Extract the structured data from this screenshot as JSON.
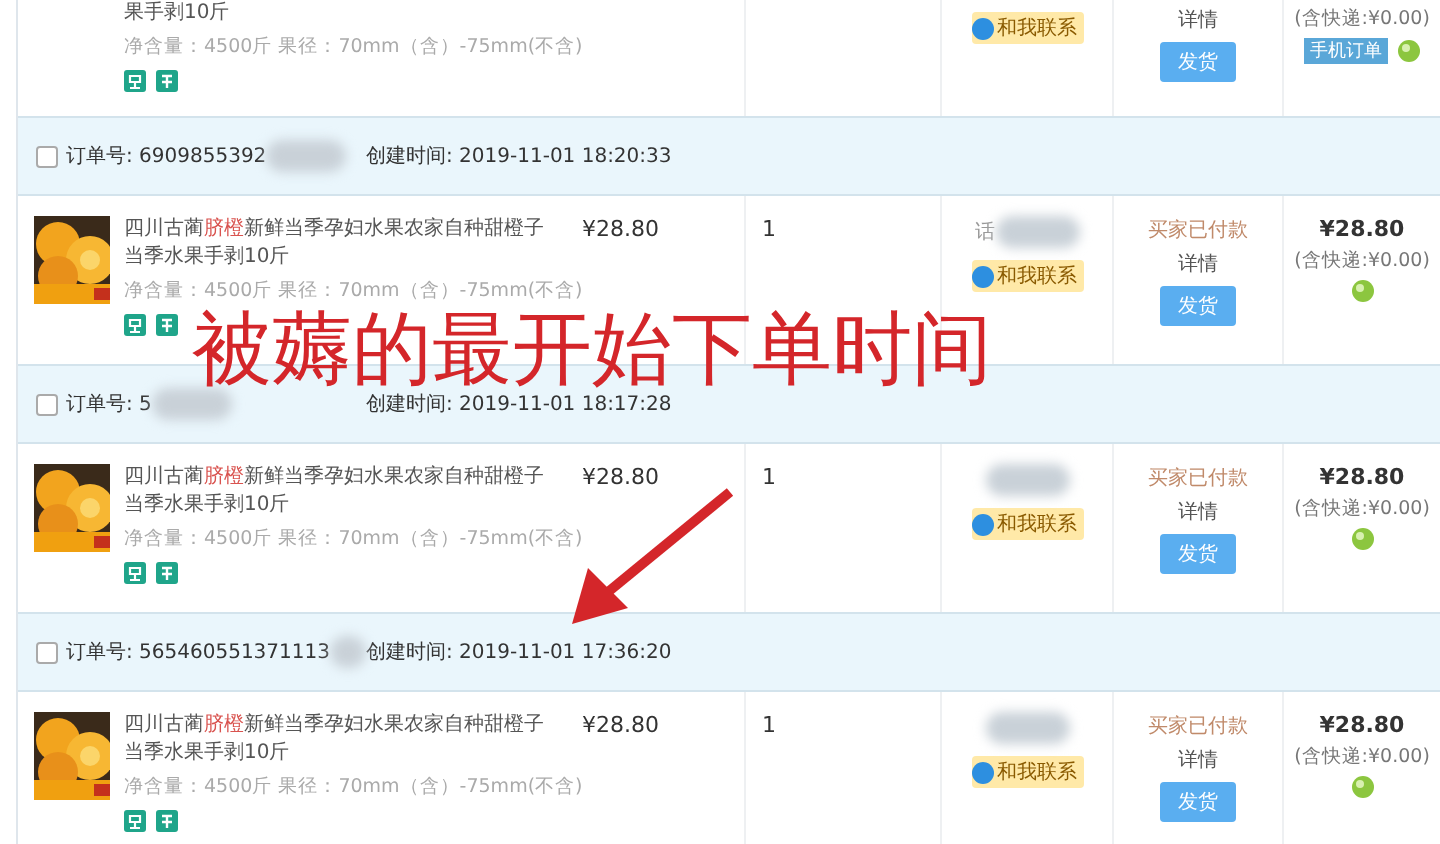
{
  "orders": [
    {
      "product": {
        "title_parts": [
          {
            "text": "果手剥10斤",
            "highlighted": false
          }
        ],
        "spec": "净含量：4500斤  果径：70mm（含）-75mm(不含)"
      },
      "buyer": {
        "contact": "和我联系"
      },
      "status": {
        "details": "详情",
        "button": "发货"
      },
      "total": {
        "shipping": "(含快递:¥0.00)",
        "mobile_tag": "手机订单"
      }
    },
    {
      "header": {
        "order_no": "订单号: 6909855392",
        "redacted": true,
        "created": "创建时间: 2019-11-01 18:20:33",
        "checked": false
      },
      "product": {
        "title_parts": [
          {
            "text": "四川古蔺",
            "highlighted": false
          },
          {
            "text": "脐橙",
            "highlighted": true
          },
          {
            "text": "新鲜当季孕妇水果农家自种甜橙子当季水果手剥10斤",
            "highlighted": false
          }
        ],
        "spec": "净含量：4500斤  果径：70mm（含）-75mm(不含)"
      },
      "price": "¥28.80",
      "quantity": "1",
      "buyer": {
        "name": "话",
        "redacted": true,
        "contact": "和我联系"
      },
      "status": {
        "state": "买家已付款",
        "details": "详情",
        "button": "发货"
      },
      "total": {
        "amount": "¥28.80",
        "shipping": "(含快递:¥0.00)"
      }
    },
    {
      "header": {
        "order_no": "订单号: 5",
        "redacted": true,
        "created": "创建时间: 2019-11-01 18:17:28",
        "checked": false
      },
      "product": {
        "title_parts": [
          {
            "text": "四川古蔺",
            "highlighted": false
          },
          {
            "text": "脐橙",
            "highlighted": true
          },
          {
            "text": "新鲜当季孕妇水果农家自种甜橙子当季水果手剥10斤",
            "highlighted": false
          }
        ],
        "spec": "净含量：4500斤  果径：70mm（含）-75mm(不含)"
      },
      "price": "¥28.80",
      "quantity": "1",
      "buyer": {
        "redacted": true,
        "contact": "和我联系"
      },
      "status": {
        "state": "买家已付款",
        "details": "详情",
        "button": "发货"
      },
      "total": {
        "amount": "¥28.80",
        "shipping": "(含快递:¥0.00)"
      }
    },
    {
      "header": {
        "order_no": "订单号: 565460551371113",
        "redacted": true,
        "created": "创建时间: 2019-11-01 17:36:20",
        "checked": false
      },
      "product": {
        "title_parts": [
          {
            "text": "四川古蔺",
            "highlighted": false
          },
          {
            "text": "脐橙",
            "highlighted": true
          },
          {
            "text": "新鲜当季孕妇水果农家自种甜橙子当季水果手剥10斤",
            "highlighted": false
          }
        ],
        "spec": "净含量：4500斤  果径：70mm（含）-75mm(不含)"
      },
      "price": "¥28.80",
      "quantity": "1",
      "buyer": {
        "redacted": true,
        "contact": "和我联系"
      },
      "status": {
        "state": "买家已付款",
        "details": "详情",
        "button": "发货"
      },
      "total": {
        "amount": "¥28.80",
        "shipping": "(含快递:¥0.00)"
      }
    }
  ],
  "annotation": {
    "text": "被薅的最开始下单时间",
    "arrow": true
  }
}
